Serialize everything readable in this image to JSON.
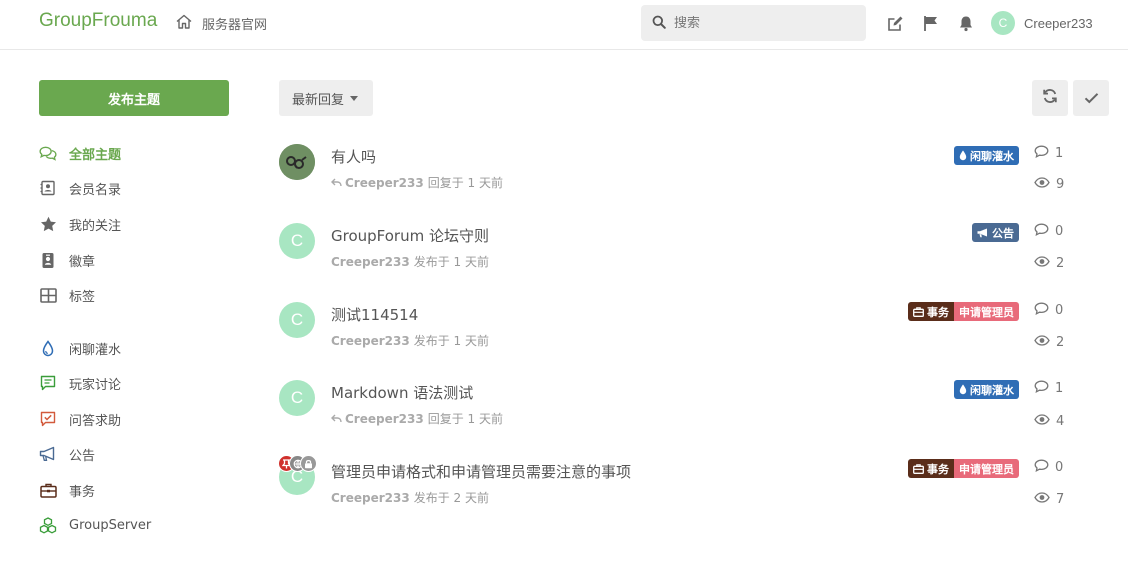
{
  "header": {
    "logo": "GroupFrouma",
    "home_link": "服务器官网",
    "search_placeholder": "搜索",
    "user_initial": "C",
    "user_name": "Creeper233"
  },
  "sidebar": {
    "new_topic": "发布主题",
    "items": [
      {
        "label": "全部主题",
        "icon": "comments-icon"
      },
      {
        "label": "会员名录",
        "icon": "address-book-icon"
      },
      {
        "label": "我的关注",
        "icon": "star-icon"
      },
      {
        "label": "徽章",
        "icon": "id-badge-icon"
      },
      {
        "label": "标签",
        "icon": "th-large-icon"
      },
      {
        "label": "闲聊灌水",
        "icon": "water-drop-icon"
      },
      {
        "label": "玩家讨论",
        "icon": "comment-alt-icon"
      },
      {
        "label": "问答求助",
        "icon": "question-check-icon"
      },
      {
        "label": "公告",
        "icon": "bullhorn-icon"
      },
      {
        "label": "事务",
        "icon": "briefcase-icon"
      },
      {
        "label": "GroupServer",
        "icon": "cubes-icon"
      }
    ]
  },
  "toolbar": {
    "sort_label": "最新回复"
  },
  "topics": [
    {
      "title": "有人吗",
      "author": "Creeper233",
      "action": "回复于 1 天前",
      "replies": "1",
      "views": "9",
      "tags": [
        "闲聊灌水"
      ],
      "avatar": ""
    },
    {
      "title": "GroupForum 论坛守则",
      "author": "Creeper233",
      "action": "发布于 1 天前",
      "replies": "0",
      "views": "2",
      "tags": [
        "公告"
      ],
      "avatar": "C"
    },
    {
      "title": "测试114514",
      "author": "Creeper233",
      "action": "发布于 1 天前",
      "replies": "0",
      "views": "2",
      "tags": [
        "事务",
        "申请管理员"
      ],
      "avatar": "C"
    },
    {
      "title": "Markdown 语法测试",
      "author": "Creeper233",
      "action": "回复于 1 天前",
      "replies": "1",
      "views": "4",
      "tags": [
        "闲聊灌水"
      ],
      "avatar": "C"
    },
    {
      "title": "管理员申请格式和申请管理员需要注意的事项",
      "author": "Creeper233",
      "action": "发布于 2 天前",
      "replies": "0",
      "views": "7",
      "tags": [
        "事务",
        "申请管理员"
      ],
      "avatar": "C"
    }
  ],
  "colors": {
    "brand": "#6aa84f",
    "tag_chat": "#2f6db5",
    "tag_announce": "#4a6a93",
    "tag_affairs": "#5a2d1a",
    "tag_admin": "#e86a7a"
  }
}
